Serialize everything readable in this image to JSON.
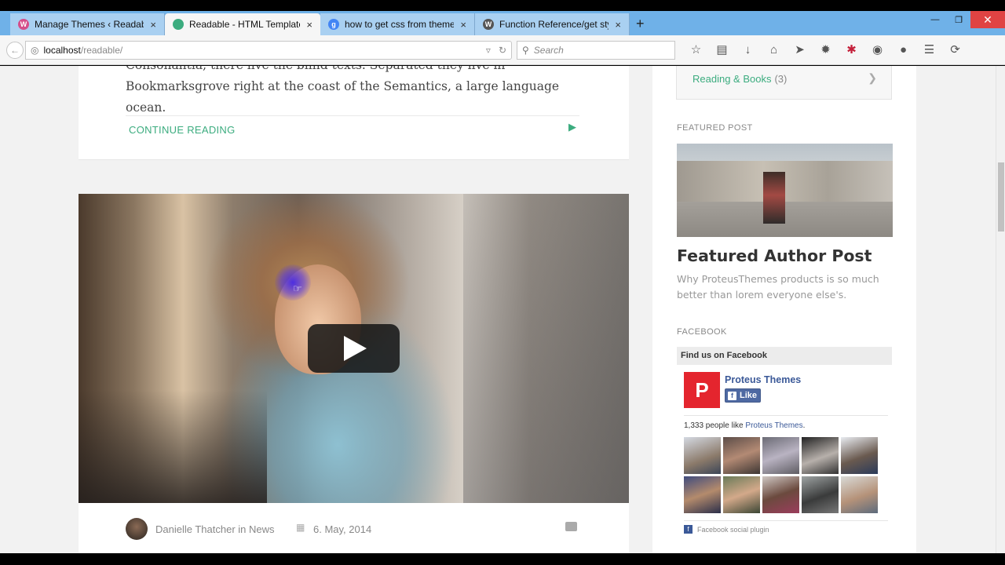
{
  "browser": {
    "tabs": [
      {
        "label": "Manage Themes ‹ Readabl...",
        "icon": "wordpress-admin-icon",
        "color": "#d54e8a",
        "active": false
      },
      {
        "label": "Readable - HTML Template",
        "icon": "readable-icon",
        "color": "#3cac7f",
        "active": true
      },
      {
        "label": "how to get css from theme...",
        "icon": "google-icon",
        "color": "#4285f4",
        "active": false
      },
      {
        "label": "Function Reference/get sty...",
        "icon": "wordpress-icon",
        "color": "#555555",
        "active": false
      }
    ],
    "close_glyph": "×",
    "new_tab_glyph": "+",
    "url_host": "localhost",
    "url_path": "/readable/",
    "search_placeholder": "Search"
  },
  "post1": {
    "excerpt": "Consonantia, there live the blind texts. Separated they live in Bookmarksgrove right at the coast of the Semantics, a large language ocean.",
    "continue_label": "CONTINUE READING"
  },
  "post2": {
    "author_line": "Danielle Thatcher in News",
    "date": "6. May, 2014"
  },
  "sidebar": {
    "category": {
      "label": "Reading & Books",
      "count": "(3)"
    },
    "featured_heading": "FEATURED POST",
    "featured_title": "Featured Author Post",
    "featured_text": "Why ProteusThemes products is so much better than lorem everyone else's.",
    "facebook_heading": "FACEBOOK",
    "fb_bar": "Find us on Facebook",
    "fb_page_name": "Proteus Themes",
    "fb_like": "Like",
    "fb_count_prefix": "1,333 people like ",
    "fb_count_link": "Proteus Themes",
    "fb_count_suffix": ".",
    "fb_plugin": "Facebook social plugin"
  },
  "colors": {
    "accent": "#3cac7f",
    "facebook": "#3b5998",
    "brand_red": "#e4252e"
  }
}
